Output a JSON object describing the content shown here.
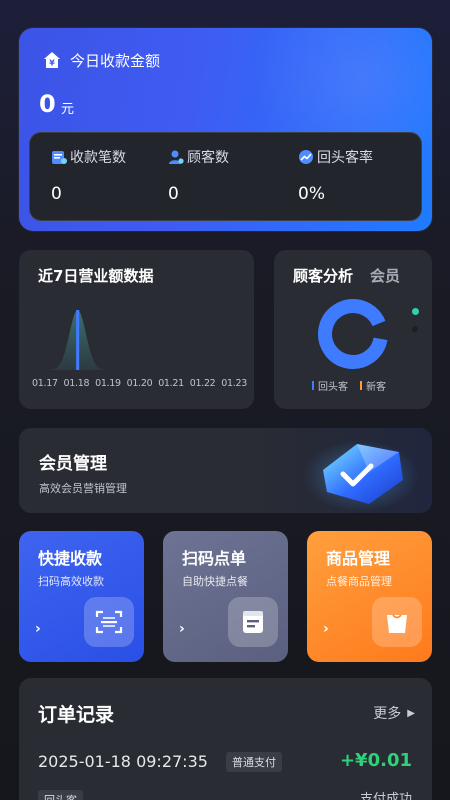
{
  "revenue": {
    "title": "今日收款金额",
    "amount": "0",
    "unit": "元",
    "stats": [
      {
        "label": "收款笔数",
        "value": "0",
        "icon": "receipt-icon"
      },
      {
        "label": "顾客数",
        "value": "0",
        "icon": "customer-icon"
      },
      {
        "label": "回头客率",
        "value": "0%",
        "icon": "trend-icon"
      }
    ]
  },
  "sales": {
    "title": "近7日营业额数据",
    "chart_data": {
      "type": "area",
      "x": [
        "01.17",
        "01.18",
        "01.19",
        "01.20",
        "01.21",
        "01.22",
        "01.23"
      ],
      "values": [
        0,
        0.01,
        0,
        0,
        0,
        0,
        0
      ]
    }
  },
  "customers": {
    "title": "顾客分析",
    "tab_member": "会员",
    "legend": [
      {
        "label": "回头客",
        "color": "#3f7bff"
      },
      {
        "label": "新客",
        "color": "#ff9b3b"
      }
    ]
  },
  "member": {
    "title": "会员管理",
    "subtitle": "高效会员营销管理"
  },
  "quick": [
    {
      "title": "快捷收款",
      "subtitle": "扫码高效收款",
      "arrow": "›"
    },
    {
      "title": "扫码点单",
      "subtitle": "自助快捷点餐",
      "arrow": "›"
    },
    {
      "title": "商品管理",
      "subtitle": "点餐商品管理",
      "arrow": "›"
    }
  ],
  "orders": {
    "title": "订单记录",
    "more": "更多",
    "items": [
      {
        "time": "2025-01-18 09:27:35",
        "type": "普通支付",
        "amount": "+¥0.01",
        "customer": "回头客",
        "status": "支付成功"
      }
    ]
  }
}
